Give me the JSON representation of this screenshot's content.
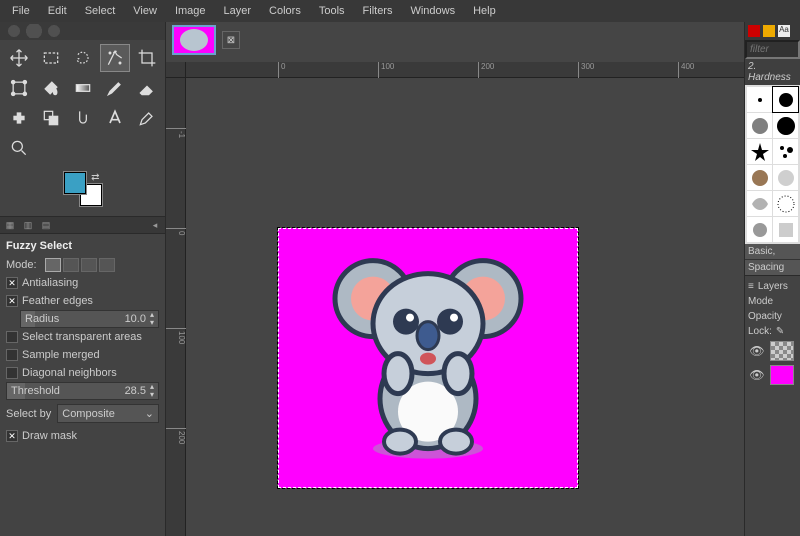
{
  "menubar": [
    "File",
    "Edit",
    "Select",
    "View",
    "Image",
    "Layer",
    "Colors",
    "Tools",
    "Filters",
    "Windows",
    "Help"
  ],
  "toolbox_tools": [
    "move-tool",
    "rect-select-tool",
    "free-select-tool",
    "fuzzy-select-tool",
    "crop-tool",
    "transform-tool",
    "bucket-fill-tool",
    "gradient-tool",
    "paintbrush-tool",
    "eraser-tool",
    "heal-tool",
    "clone-tool",
    "smudge-tool",
    "text-tool",
    "color-picker-tool",
    "zoom-tool"
  ],
  "colors": {
    "fg": "#3aa0c4",
    "bg": "#ffffff"
  },
  "tool_options": {
    "title": "Fuzzy Select",
    "mode_label": "Mode:",
    "antialiasing": {
      "label": "Antialiasing",
      "checked": true
    },
    "feather": {
      "label": "Feather edges",
      "checked": true
    },
    "radius": {
      "label": "Radius",
      "value": "10.0"
    },
    "select_transparent": {
      "label": "Select transparent areas",
      "checked": false
    },
    "sample_merged": {
      "label": "Sample merged",
      "checked": false
    },
    "diagonal_neighbors": {
      "label": "Diagonal neighbors",
      "checked": false
    },
    "threshold": {
      "label": "Threshold",
      "value": "28.5"
    },
    "select_by": {
      "label": "Select by",
      "value": "Composite"
    },
    "draw_mask": {
      "label": "Draw mask",
      "checked": true
    }
  },
  "ruler_h": [
    {
      "pos": 14,
      "label": "0"
    },
    {
      "pos": 114,
      "label": "100"
    },
    {
      "pos": 214,
      "label": "200"
    },
    {
      "pos": 314,
      "label": "300"
    },
    {
      "pos": 414,
      "label": "400"
    }
  ],
  "ruler_v": [
    {
      "pos": 10,
      "label": "-1"
    },
    {
      "pos": 110,
      "label": "0"
    },
    {
      "pos": 210,
      "label": "100"
    },
    {
      "pos": 310,
      "label": "200"
    }
  ],
  "right_panel": {
    "filter_placeholder": "filter",
    "brush_subtitle": "2. Hardness",
    "basic_label": "Basic,",
    "spacing_label": "Spacing",
    "layers_label": "Layers",
    "mode_label": "Mode",
    "opacity_label": "Opacity",
    "lock_label": "Lock:"
  },
  "canvas": {
    "bg": "#ff00ff"
  }
}
